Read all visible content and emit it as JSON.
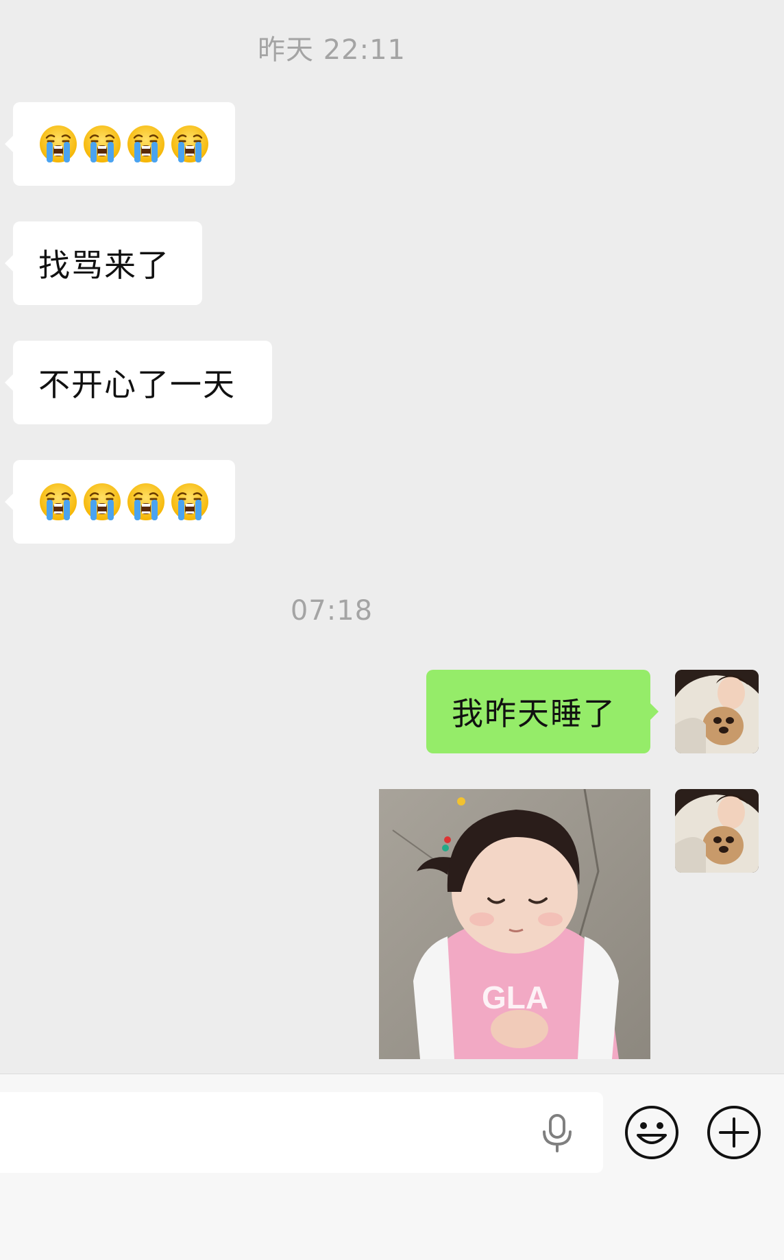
{
  "chat": {
    "timestamps": [
      "昨天 22:11",
      "07:18"
    ],
    "messages": [
      {
        "side": "left",
        "type": "emoji",
        "emoji": "loudly-crying-face",
        "count": 4
      },
      {
        "side": "left",
        "type": "text",
        "text": "找骂来了"
      },
      {
        "side": "left",
        "type": "text",
        "text": "不开心了一天"
      },
      {
        "side": "left",
        "type": "emoji",
        "emoji": "loudly-crying-face",
        "count": 4
      },
      {
        "side": "right",
        "type": "text",
        "text": "我昨天睡了"
      },
      {
        "side": "right",
        "type": "image",
        "image": "toddler-pink-shirt-sticker"
      }
    ]
  },
  "input_bar": {
    "voice_icon": "microphone-icon",
    "emoji_icon": "smiley-icon",
    "more_icon": "plus-circle-icon"
  },
  "colors": {
    "background": "#ededed",
    "incoming_bubble": "#ffffff",
    "outgoing_bubble": "#95ec69",
    "timestamp": "#a4a4a4"
  }
}
